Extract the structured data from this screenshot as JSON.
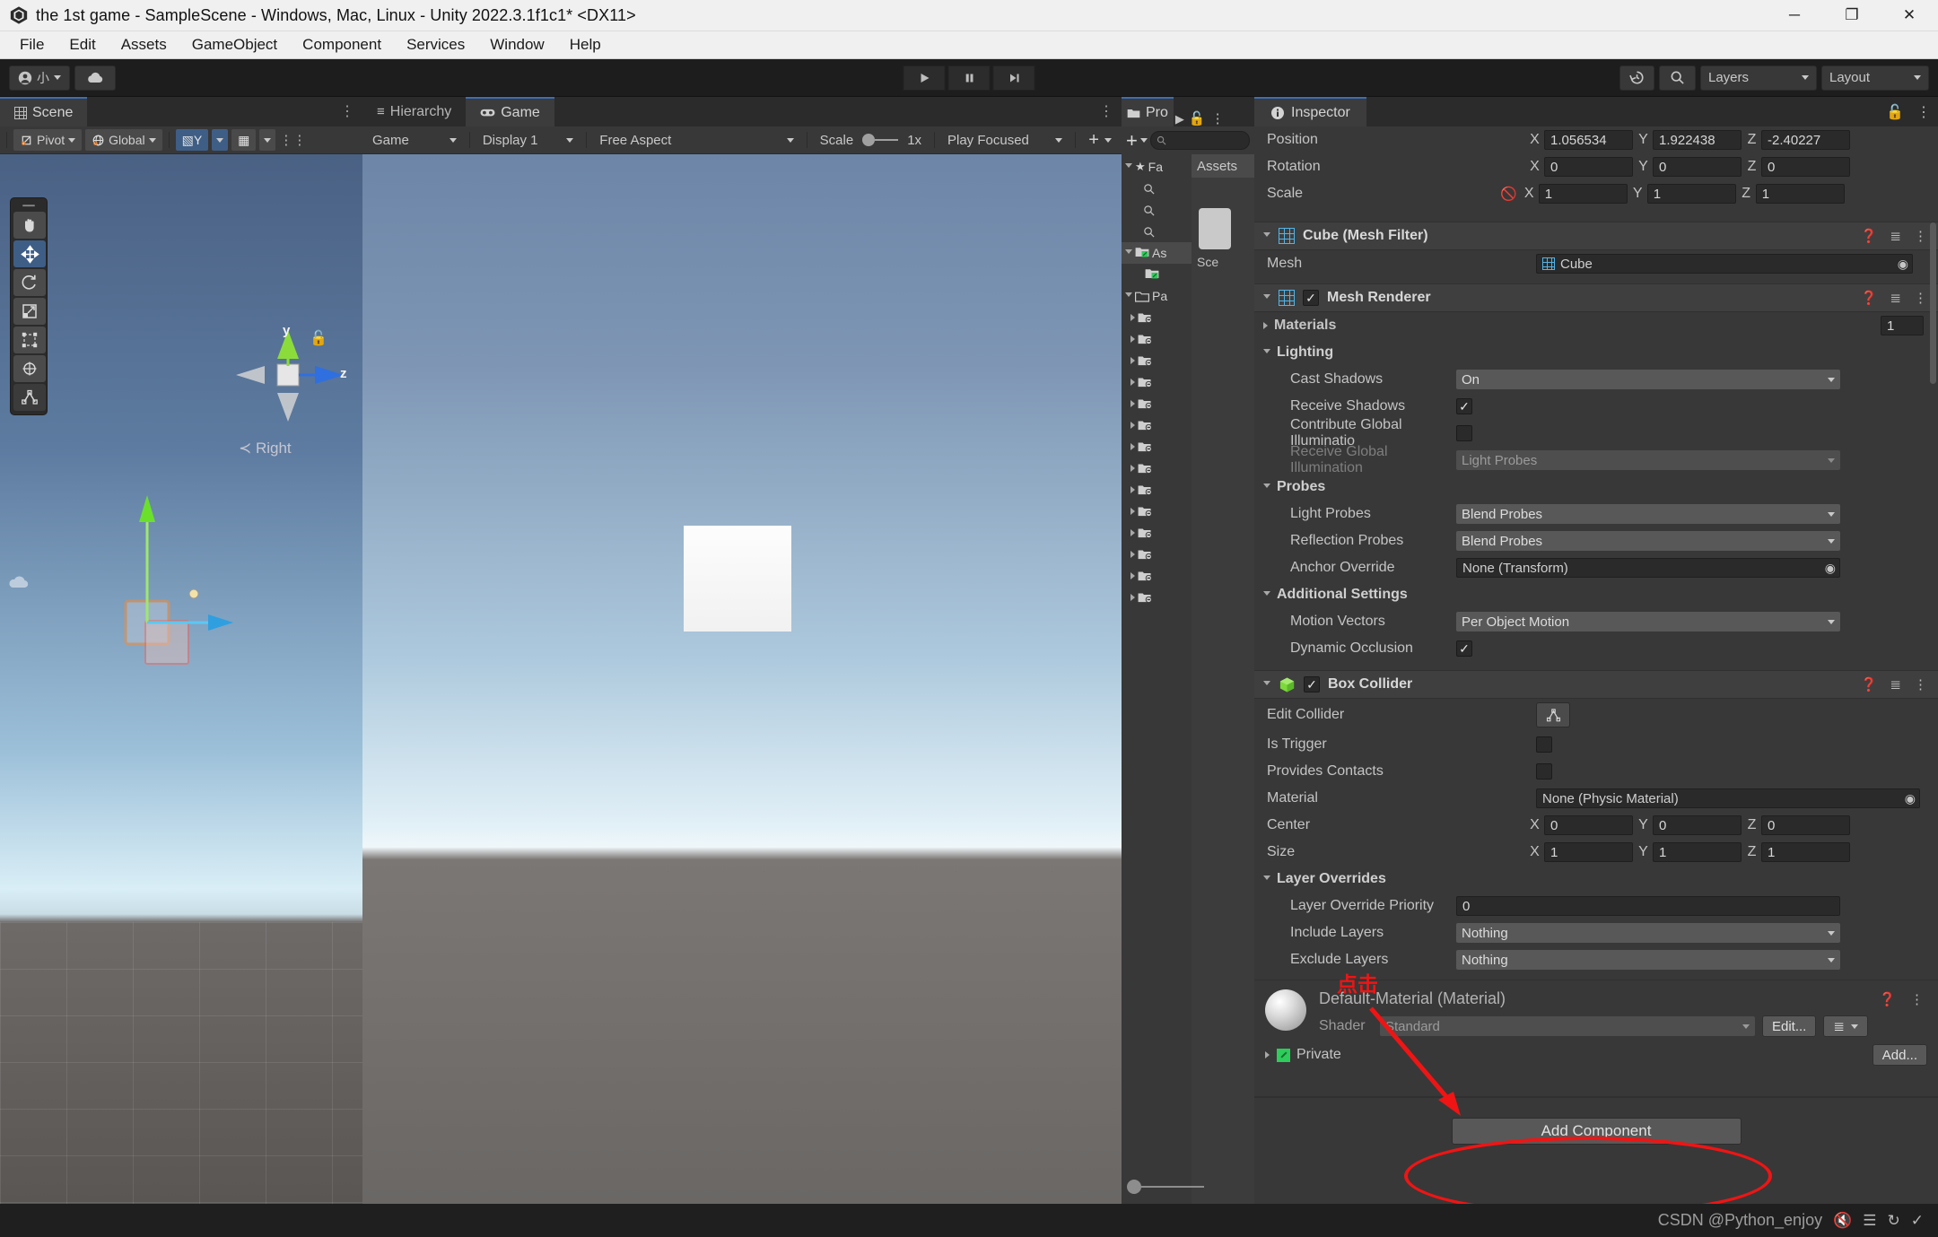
{
  "window": {
    "title": "the 1st game - SampleScene - Windows, Mac, Linux - Unity 2022.3.1f1c1* <DX11>",
    "app_icon": "unity-logo-icon",
    "minimize": "─",
    "maximize": "❐",
    "close": "✕"
  },
  "menubar": {
    "items": [
      "File",
      "Edit",
      "Assets",
      "GameObject",
      "Component",
      "Services",
      "Window",
      "Help"
    ]
  },
  "toolbar": {
    "account_label": "小",
    "cloud_icon": "cloud-icon",
    "play": "▶",
    "pause": "‖",
    "step": "▶|",
    "history_icon": "undo-history-icon",
    "search_icon": "search-icon",
    "layers_label": "Layers",
    "layout_label": "Layout"
  },
  "scene": {
    "tab_label": "Scene",
    "tab_icon": "grid-icon",
    "pivot_label": "Pivot",
    "global_label": "Global",
    "tools": [
      {
        "name": "hand-tool",
        "glyph": "✋"
      },
      {
        "name": "move-tool",
        "glyph": "✥"
      },
      {
        "name": "rotate-tool",
        "glyph": "↺"
      },
      {
        "name": "scale-tool",
        "glyph": "↗"
      },
      {
        "name": "rect-tool",
        "glyph": "⬚"
      },
      {
        "name": "transform-tool",
        "glyph": "⎈"
      },
      {
        "name": "custom-tool",
        "glyph": "⛩"
      }
    ],
    "gizmo": {
      "y_label": "y",
      "z_label": "z",
      "view_label": "≺ Right",
      "lock_icon": "unlocked-padlock-icon"
    }
  },
  "hierarchy": {
    "tab_label": "Hierarchy",
    "tab_icon": "list-icon"
  },
  "game": {
    "tab_label": "Game",
    "tab_icon": "gamepad-icon",
    "mode_label": "Game",
    "display_label": "Display 1",
    "aspect_label": "Free Aspect",
    "scale_label": "Scale",
    "scale_value": "1x",
    "play_mode_label": "Play Focused",
    "add_label": "+"
  },
  "project": {
    "tab_label": "Pro",
    "tab_icon": "folder-icon",
    "lock_icon": "padlock-icon",
    "add_label": "+",
    "search_placeholder": "",
    "search_icon": "search-icon",
    "tree": [
      {
        "label": "Fa",
        "icon": "star-icon",
        "expanded": true,
        "indent": 0
      },
      {
        "label": "",
        "icon": "search-icon",
        "expanded": false,
        "indent": 1
      },
      {
        "label": "",
        "icon": "search-icon",
        "expanded": false,
        "indent": 1
      },
      {
        "label": "",
        "icon": "search-icon",
        "expanded": false,
        "indent": 1
      },
      {
        "label": "As",
        "icon": "assets-folder-icon",
        "expanded": true,
        "indent": 0,
        "selected": true
      },
      {
        "label": "",
        "icon": "folder-icon",
        "expanded": false,
        "indent": 1
      },
      {
        "label": "Pa",
        "icon": "folder-icon",
        "expanded": true,
        "indent": 0
      },
      {
        "label": "",
        "icon": "package-folder-icon",
        "expanded": false,
        "indent": 1
      },
      {
        "label": "",
        "icon": "package-folder-icon",
        "expanded": false,
        "indent": 1
      },
      {
        "label": "",
        "icon": "package-folder-icon",
        "expanded": false,
        "indent": 1
      },
      {
        "label": "",
        "icon": "package-folder-icon",
        "expanded": false,
        "indent": 1
      },
      {
        "label": "",
        "icon": "package-folder-icon",
        "expanded": false,
        "indent": 1
      },
      {
        "label": "",
        "icon": "package-folder-icon",
        "expanded": false,
        "indent": 1
      },
      {
        "label": "",
        "icon": "package-folder-icon",
        "expanded": false,
        "indent": 1
      },
      {
        "label": "",
        "icon": "package-folder-icon",
        "expanded": false,
        "indent": 1
      },
      {
        "label": "",
        "icon": "package-folder-icon",
        "expanded": false,
        "indent": 1
      },
      {
        "label": "",
        "icon": "package-folder-icon",
        "expanded": false,
        "indent": 1
      },
      {
        "label": "",
        "icon": "package-folder-icon",
        "expanded": false,
        "indent": 1
      },
      {
        "label": "",
        "icon": "package-folder-icon",
        "expanded": false,
        "indent": 1
      },
      {
        "label": "",
        "icon": "package-folder-icon",
        "expanded": false,
        "indent": 1
      },
      {
        "label": "",
        "icon": "package-folder-icon",
        "expanded": false,
        "indent": 1
      }
    ],
    "breadcrumb": "Assets",
    "asset_name": "Sce"
  },
  "inspector": {
    "tab_label": "Inspector",
    "tab_icon": "info-icon",
    "lock_icon": "padlock-icon",
    "kebab_icon": "kebab-menu-icon",
    "transform": {
      "position": {
        "label": "Position",
        "x": "1.056534",
        "y": "1.922438",
        "z": "-2.40227"
      },
      "rotation": {
        "label": "Rotation",
        "x": "0",
        "y": "0",
        "z": "0"
      },
      "scale": {
        "label": "Scale",
        "x": "1",
        "y": "1",
        "z": "1",
        "constrain_icon": "linked-scale-off-icon"
      }
    },
    "mesh_filter": {
      "title": "Cube (Mesh Filter)",
      "icon": "mesh-filter-icon",
      "mesh_label": "Mesh",
      "mesh_value": "Cube"
    },
    "mesh_renderer": {
      "title": "Mesh Renderer",
      "icon": "mesh-renderer-icon",
      "enabled": true,
      "materials_label": "Materials",
      "materials_count": "1",
      "lighting_label": "Lighting",
      "cast_shadows_label": "Cast Shadows",
      "cast_shadows_value": "On",
      "receive_shadows_label": "Receive Shadows",
      "receive_shadows_value": true,
      "contribute_gi_label": "Contribute Global Illuminatio",
      "contribute_gi_value": false,
      "receive_gi_label": "Receive Global Illumination",
      "receive_gi_value": "Light Probes",
      "probes_label": "Probes",
      "light_probes_label": "Light Probes",
      "light_probes_value": "Blend Probes",
      "reflection_probes_label": "Reflection Probes",
      "reflection_probes_value": "Blend Probes",
      "anchor_override_label": "Anchor Override",
      "anchor_override_value": "None (Transform)",
      "additional_settings_label": "Additional Settings",
      "motion_vectors_label": "Motion Vectors",
      "motion_vectors_value": "Per Object Motion",
      "dynamic_occlusion_label": "Dynamic Occlusion",
      "dynamic_occlusion_value": true
    },
    "box_collider": {
      "title": "Box Collider",
      "icon": "box-collider-icon",
      "enabled": true,
      "edit_collider_label": "Edit Collider",
      "edit_collider_icon": "edit-collider-icon",
      "is_trigger_label": "Is Trigger",
      "is_trigger_value": false,
      "provides_contacts_label": "Provides Contacts",
      "provides_contacts_value": false,
      "material_label": "Material",
      "material_value": "None (Physic Material)",
      "center": {
        "label": "Center",
        "x": "0",
        "y": "0",
        "z": "0"
      },
      "size": {
        "label": "Size",
        "x": "1",
        "y": "1",
        "z": "1"
      },
      "layer_overrides_label": "Layer Overrides",
      "layer_override_priority_label": "Layer Override Priority",
      "layer_override_priority_value": "0",
      "include_layers_label": "Include Layers",
      "include_layers_value": "Nothing",
      "exclude_layers_label": "Exclude Layers",
      "exclude_layers_value": "Nothing"
    },
    "material": {
      "title": "Default-Material (Material)",
      "preview_icon": "material-sphere-icon",
      "shader_label": "Shader",
      "shader_value": "Standard",
      "edit_label": "Edit...",
      "preset_icon": "preset-list-icon",
      "private_label": "Private",
      "private_value": true,
      "add_label": "Add..."
    },
    "add_component_label": "Add Component"
  },
  "annotations": {
    "click_text": "点击",
    "accent_color": "#f01414",
    "arrow": "arrow-annotation",
    "ellipse": "ellipse-annotation"
  },
  "statusbar": {
    "watermark": "CSDN @Python_enjoy",
    "icons": [
      "mute-icon",
      "layers-status-icon",
      "refresh-off-icon",
      "check-circle-icon"
    ]
  }
}
